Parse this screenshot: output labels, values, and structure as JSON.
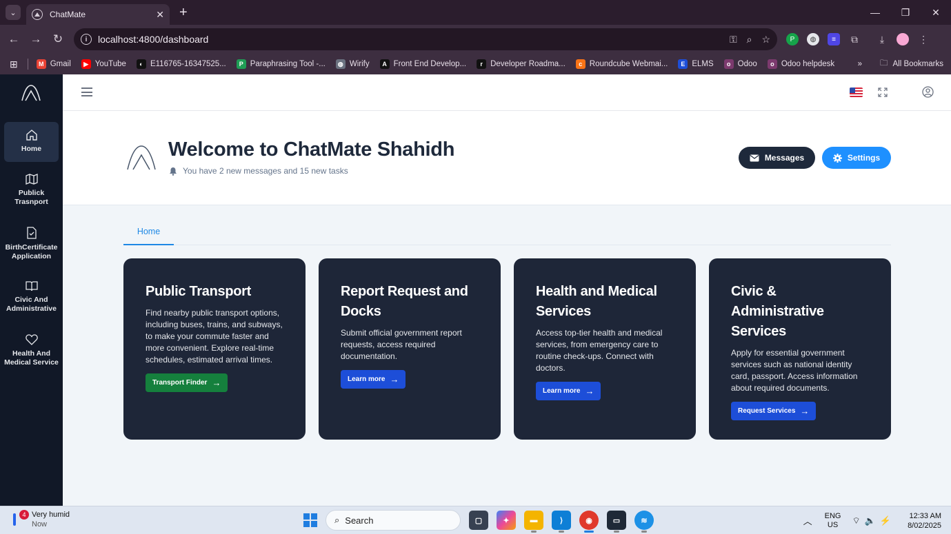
{
  "browser": {
    "tab_title": "ChatMate",
    "url": "localhost:4800/dashboard",
    "bookmarks": [
      {
        "label": "Gmail",
        "color": "#ea4335",
        "glyph": "M"
      },
      {
        "label": "YouTube",
        "color": "#ff0000",
        "glyph": "▶"
      },
      {
        "label": "E116765-16347525...",
        "color": "#111111",
        "glyph": "◐"
      },
      {
        "label": "Paraphrasing Tool -...",
        "color": "#1f9d55",
        "glyph": "P"
      },
      {
        "label": "Wirify",
        "color": "#6b7280",
        "glyph": "◍"
      },
      {
        "label": "Front End Develop...",
        "color": "#111111",
        "glyph": "A"
      },
      {
        "label": "Developer Roadma...",
        "color": "#111111",
        "glyph": "r"
      },
      {
        "label": "Roundcube Webmai...",
        "color": "#f97316",
        "glyph": "c"
      },
      {
        "label": "ELMS",
        "color": "#1d4ed8",
        "glyph": "E"
      },
      {
        "label": "Odoo",
        "color": "#7c3a6e",
        "glyph": "o"
      },
      {
        "label": "Odoo helpdesk",
        "color": "#7c3a6e",
        "glyph": "o"
      }
    ],
    "all_bookmarks": "All Bookmarks",
    "more": "»"
  },
  "sidebar": {
    "items": [
      {
        "label": "Home",
        "icon": "home-icon"
      },
      {
        "label": "Publick Trasnport",
        "icon": "map-icon"
      },
      {
        "label": "BirthCertificate Application",
        "icon": "file-check-icon"
      },
      {
        "label": "Civic And Administrative",
        "icon": "book-open-icon"
      },
      {
        "label": "Health And Medical Service",
        "icon": "heart-icon"
      }
    ]
  },
  "welcome": {
    "title": "Welcome to ChatMate Shahidh",
    "subtitle": "You have 2 new messages and 15 new tasks",
    "messages_label": "Messages",
    "settings_label": "Settings"
  },
  "tabs": {
    "home": "Home"
  },
  "cards": [
    {
      "title": "Public Transport",
      "text": "Find nearby public transport options, including buses, trains, and subways, to make your commute faster and more convenient. Explore real-time schedules, estimated arrival times.",
      "cta": "Transport Finder",
      "cta_color": "#15803d"
    },
    {
      "title": "Report Request and Docks",
      "text": "Submit official government report requests, access required documentation.",
      "cta": "Learn more",
      "cta_color": "#1d4ed8"
    },
    {
      "title": "Health and Medical Services",
      "text": "Access top-tier health and medical services, from emergency care to routine check-ups. Connect with doctors.",
      "cta": "Learn more",
      "cta_color": "#1d4ed8"
    },
    {
      "title": "Civic & Administrative Services",
      "text": "Apply for essential government services such as national identity card, passport. Access information about required documents.",
      "cta": "Request Services",
      "cta_color": "#1d4ed8"
    }
  ],
  "taskbar": {
    "weather": "Very humid",
    "weather_sub": "Now",
    "badge": "4",
    "search": "Search",
    "lang_top": "ENG",
    "lang_bottom": "US",
    "time": "12:33 AM",
    "date": "8/02/2025"
  }
}
